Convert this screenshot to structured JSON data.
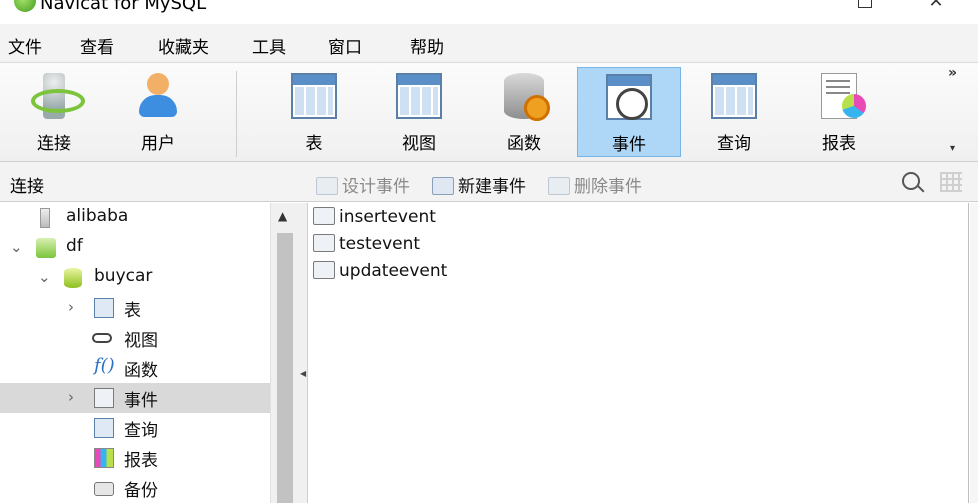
{
  "window": {
    "title": "Navicat for MySQL"
  },
  "menu": [
    "文件",
    "查看",
    "收藏夹",
    "工具",
    "窗口",
    "帮助"
  ],
  "toolbar": {
    "buttons": [
      {
        "label": "连接",
        "icon": "connection-icon"
      },
      {
        "label": "用户",
        "icon": "user-icon"
      },
      {
        "label": "表",
        "icon": "table-icon"
      },
      {
        "label": "视图",
        "icon": "view-icon"
      },
      {
        "label": "函数",
        "icon": "function-icon"
      },
      {
        "label": "事件",
        "icon": "event-icon",
        "active": true
      },
      {
        "label": "查询",
        "icon": "query-icon"
      },
      {
        "label": "报表",
        "icon": "report-icon"
      }
    ],
    "more": "»",
    "dropdown": "▾"
  },
  "subbar": {
    "title": "连接",
    "design": "设计事件",
    "create": "新建事件",
    "delete": "删除事件"
  },
  "tree": [
    {
      "label": "alibaba",
      "icon": "server-icon"
    },
    {
      "label": "df",
      "icon": "connection-icon",
      "caret": "⌄"
    },
    {
      "label": "buycar",
      "icon": "database-icon",
      "caret": "⌄"
    },
    {
      "label": "表",
      "icon": "table-icon",
      "caret": "›"
    },
    {
      "label": "视图",
      "icon": "view-icon"
    },
    {
      "label": "函数",
      "icon": "function-icon"
    },
    {
      "label": "事件",
      "icon": "event-icon",
      "caret": "›",
      "selected": true
    },
    {
      "label": "查询",
      "icon": "query-icon"
    },
    {
      "label": "报表",
      "icon": "report-icon"
    },
    {
      "label": "备份",
      "icon": "backup-icon"
    }
  ],
  "events": [
    "insertevent",
    "testevent",
    "updateevent"
  ],
  "colors": {
    "active": "#aed6f6",
    "active_border": "#76b5e8",
    "selected_row": "#d9d9d9"
  }
}
